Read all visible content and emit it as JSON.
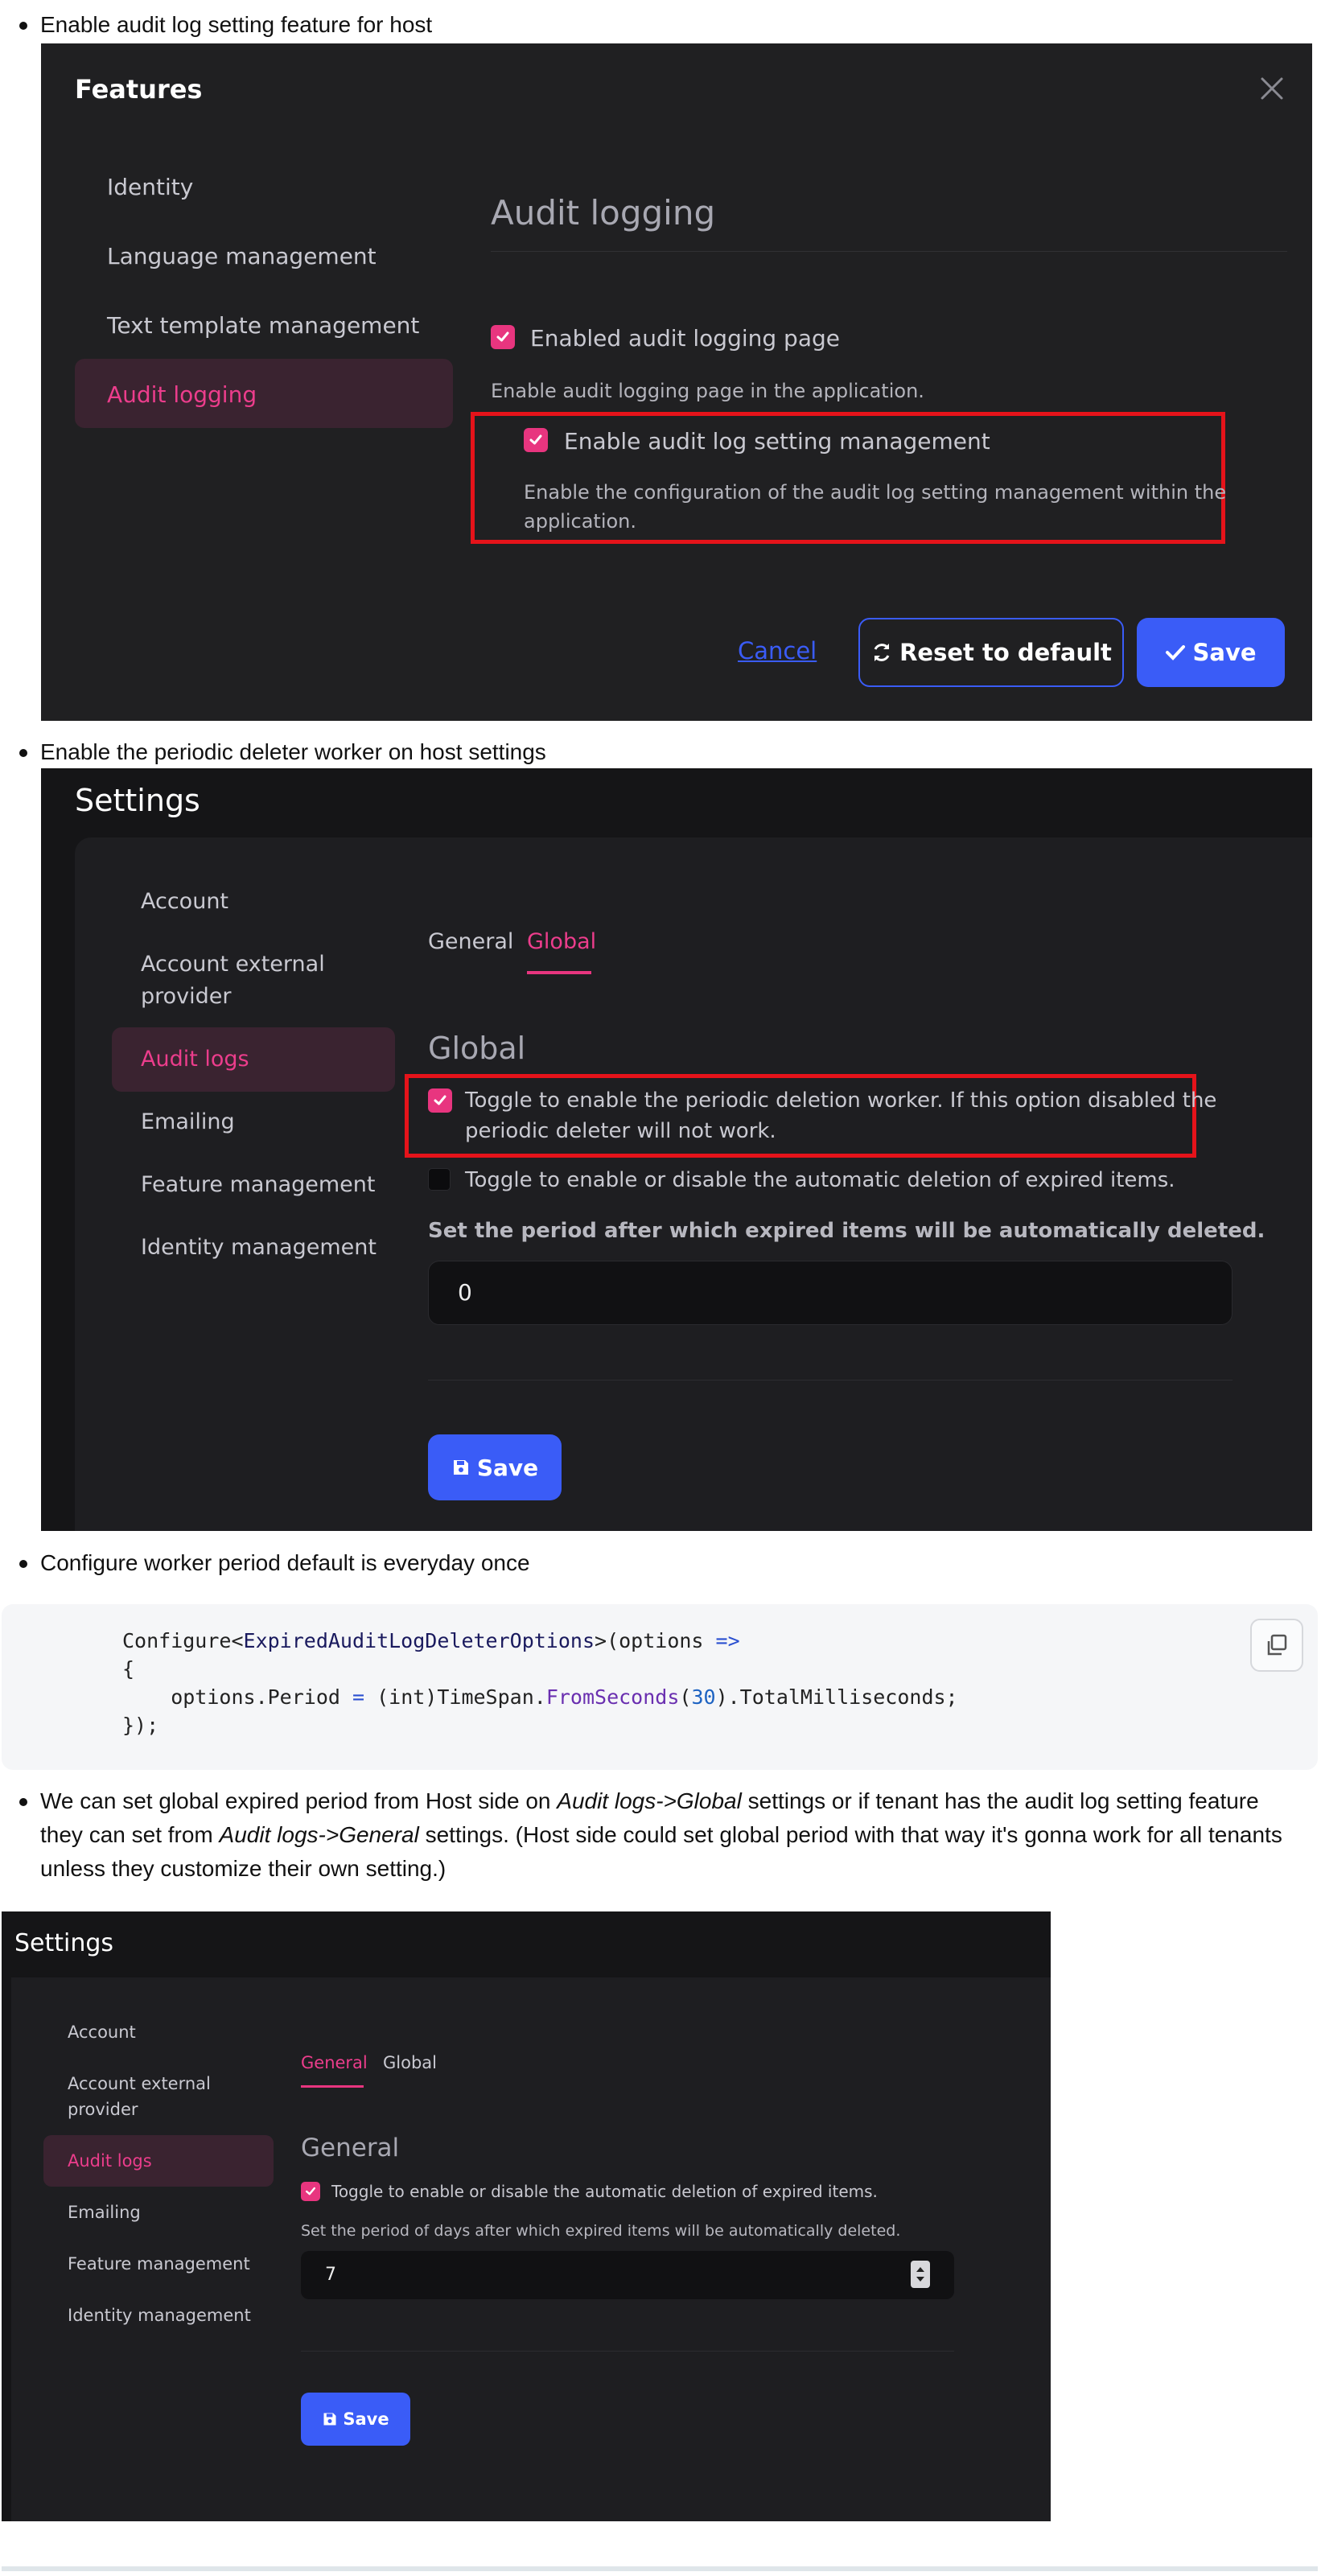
{
  "bullets": {
    "b1": "Enable audit log setting feature for host",
    "b2": "Enable the periodic deleter worker on host settings",
    "b3": "Configure worker period default is everyday once",
    "b4_parts": {
      "p1": "We can set global expired period from Host side on ",
      "p2": "Audit logs->Global",
      "p3": " settings or if tenant has the audit log setting feature they can set from ",
      "p4": "Audit logs->General",
      "p5": " settings. (Host side could set global period with that way it's gonna work for all tenants unless they customize their own setting.)"
    }
  },
  "features_modal": {
    "title": "Features",
    "nav": [
      "Identity",
      "Language management",
      "Text template management",
      "Audit logging"
    ],
    "active_nav": "Audit logging",
    "section_title": "Audit logging",
    "opt1_label": "Enabled audit logging page",
    "opt1_desc": "Enable audit logging page in the application.",
    "opt2_label": "Enable audit log setting management",
    "opt2_desc_line1": "Enable the configuration of the audit log setting management within the",
    "opt2_desc_line2": "application.",
    "cancel": "Cancel",
    "reset": "Reset to default",
    "save": "Save"
  },
  "settings1": {
    "title": "Settings",
    "nav": [
      "Account",
      "Account external",
      "provider",
      "Audit logs",
      "Emailing",
      "Feature management",
      "Identity management"
    ],
    "tabs": [
      "General",
      "Global"
    ],
    "active_tab": "Global",
    "section_title": "Global",
    "toggle1_line1": "Toggle to enable the periodic deletion worker. If this option disabled the",
    "toggle1_line2": "periodic deleter will not work.",
    "toggle2": "Toggle to enable or disable the automatic deletion of expired items.",
    "period_label": "Set the period after which expired items will be automatically deleted.",
    "period_value": "0",
    "save": "Save"
  },
  "code": {
    "line1_a": "Configure<",
    "line1_b": "ExpiredAuditLogDeleterOptions",
    "line1_c": ">(options ",
    "line1_d": "=>",
    "line2": "{",
    "line3_a": "    options.Period ",
    "line3_b": "=",
    "line3_c": " (int)TimeSpan.",
    "line3_d": "FromSeconds",
    "line3_e": "(",
    "line3_f": "30",
    "line3_g": ").TotalMilliseconds;",
    "line4": "});"
  },
  "settings2": {
    "title": "Settings",
    "nav": [
      "Account",
      "Account external",
      "provider",
      "Audit logs",
      "Emailing",
      "Feature management",
      "Identity management"
    ],
    "tabs": [
      "General",
      "Global"
    ],
    "active_tab": "General",
    "section_title": "General",
    "toggle": "Toggle to enable or disable the automatic deletion of expired items.",
    "period_label": "Set the period of days after which expired items will be automatically deleted.",
    "period_value": "7",
    "save": "Save"
  },
  "colors": {
    "accent_pink": "#e8357f",
    "primary_blue": "#3a5cf7",
    "highlight_red": "#e5131a",
    "panel_bg": "#1c1c1f"
  },
  "icons": [
    "close-icon",
    "check-icon",
    "sync-icon",
    "floppy-disk-icon",
    "copy-icon",
    "spinner-icon"
  ]
}
